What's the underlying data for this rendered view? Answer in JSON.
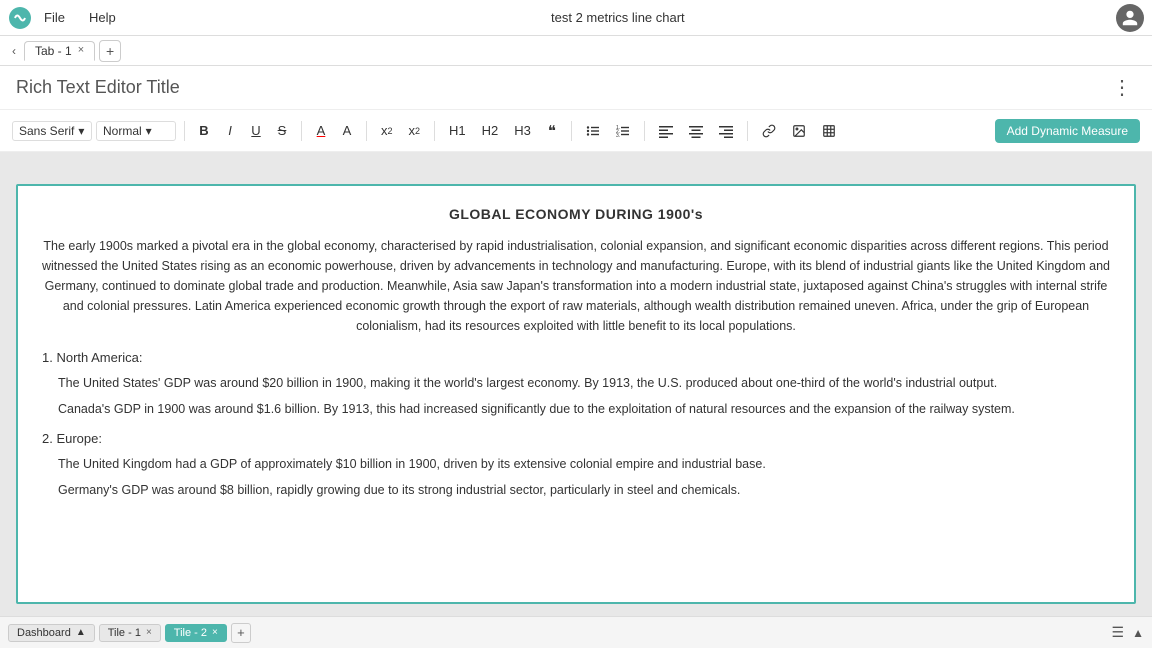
{
  "app": {
    "title": "test 2 metrics line chart"
  },
  "menu": {
    "items": [
      "File",
      "Help"
    ]
  },
  "tabs": [
    {
      "label": "Tab - 1",
      "active": true
    }
  ],
  "editor": {
    "title": "Rich Text Editor Title",
    "more_label": "⋮"
  },
  "toolbar": {
    "font_family": "Sans Serif",
    "font_style": "Normal",
    "bold": "B",
    "italic": "I",
    "underline": "U",
    "strikethrough": "S",
    "font_color": "A",
    "highlight": "A",
    "superscript": "x",
    "superscript_exp": "2",
    "subscript": "x",
    "subscript_sub": "2",
    "h1": "H1",
    "h2": "H2",
    "h3": "H3",
    "blockquote": "❝",
    "bullet_list": "≡",
    "numbered_list": "≡",
    "align_left": "≡",
    "align_center": "≡",
    "align_right": "≡",
    "link": "🔗",
    "image": "🖼",
    "table": "⊞",
    "add_measure": "Add Dynamic Measure",
    "chevron_down": "▾"
  },
  "document": {
    "title": "GLOBAL ECONOMY DURING 1900's",
    "intro": "The early 1900s marked a pivotal era in the global economy, characterised by rapid industrialisation, colonial expansion, and significant economic disparities across different regions. This period witnessed the United States rising as an economic powerhouse, driven by advancements in technology and manufacturing. Europe, with its blend of industrial giants like the United Kingdom and Germany, continued to dominate global trade and production. Meanwhile, Asia saw Japan's transformation into a modern industrial state, juxtaposed against China's struggles with internal strife and colonial pressures. Latin America experienced economic growth through the export of raw materials, although wealth distribution remained uneven. Africa, under the grip of European colonialism, had its resources exploited with little benefit to its local populations.",
    "sections": [
      {
        "heading": "1. North America:",
        "bullets": [
          "The United States' GDP was around $20 billion in 1900, making it the world's largest economy. By 1913, the U.S. produced about one-third of the world's industrial output.",
          "Canada's GDP in 1900 was around $1.6 billion. By 1913, this had increased significantly due to the exploitation of natural resources and the expansion of the railway system."
        ]
      },
      {
        "heading": "2. Europe:",
        "bullets": [
          "The United Kingdom had a GDP of approximately $10 billion in 1900, driven by its extensive colonial empire and industrial base.",
          "Germany's GDP was around $8 billion, rapidly growing due to its strong industrial sector, particularly in steel and chemicals."
        ]
      }
    ]
  },
  "bottom_tabs": [
    {
      "label": "Dashboard",
      "active": false,
      "has_chevron": true
    },
    {
      "label": "Tile - 1",
      "active": false,
      "closeable": true
    },
    {
      "label": "Tile - 2",
      "active": true,
      "closeable": true
    }
  ],
  "colors": {
    "accent": "#4db6ac",
    "toolbar_bg": "#ffffff",
    "content_bg": "#e8e8e8"
  }
}
